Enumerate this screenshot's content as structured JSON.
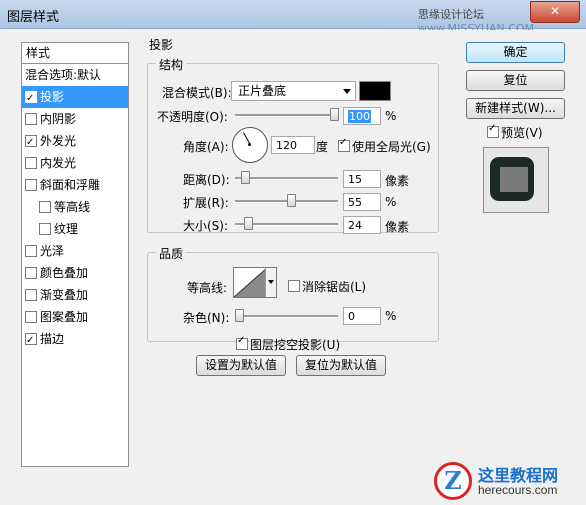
{
  "window": {
    "title": "图层样式",
    "watermark_top": "思缘设计论坛",
    "watermark_site": "www.MISSYUAN.COM"
  },
  "sidebar": {
    "header": "样式",
    "blend": "混合选项:默认",
    "items": [
      {
        "label": "投影",
        "checked": true,
        "selected": true,
        "indent": false
      },
      {
        "label": "内阴影",
        "checked": false,
        "selected": false,
        "indent": false
      },
      {
        "label": "外发光",
        "checked": true,
        "selected": false,
        "indent": false
      },
      {
        "label": "内发光",
        "checked": false,
        "selected": false,
        "indent": false
      },
      {
        "label": "斜面和浮雕",
        "checked": false,
        "selected": false,
        "indent": false
      },
      {
        "label": "等高线",
        "checked": false,
        "selected": false,
        "indent": true
      },
      {
        "label": "纹理",
        "checked": false,
        "selected": false,
        "indent": true
      },
      {
        "label": "光泽",
        "checked": false,
        "selected": false,
        "indent": false
      },
      {
        "label": "颜色叠加",
        "checked": false,
        "selected": false,
        "indent": false
      },
      {
        "label": "渐变叠加",
        "checked": false,
        "selected": false,
        "indent": false
      },
      {
        "label": "图案叠加",
        "checked": false,
        "selected": false,
        "indent": false
      },
      {
        "label": "描边",
        "checked": true,
        "selected": false,
        "indent": false
      }
    ]
  },
  "drop_shadow": {
    "section_title": "投影",
    "structure": {
      "title": "结构",
      "blend_mode_label": "混合模式(B):",
      "blend_mode_value": "正片叠底",
      "shadow_color": "#000000",
      "opacity_label": "不透明度(O):",
      "opacity_value": "100",
      "opacity_unit": "%",
      "angle_label": "角度(A):",
      "angle_value": "120",
      "angle_unit": "度",
      "global_light_label": "使用全局光(G)",
      "global_light_checked": true,
      "distance_label": "距离(D):",
      "distance_value": "15",
      "distance_unit": "像素",
      "spread_label": "扩展(R):",
      "spread_value": "55",
      "spread_unit": "%",
      "size_label": "大小(S):",
      "size_value": "24",
      "size_unit": "像素"
    },
    "quality": {
      "title": "品质",
      "contour_label": "等高线:",
      "antialias_label": "消除锯齿(L)",
      "antialias_checked": false,
      "noise_label": "杂色(N):",
      "noise_value": "0",
      "noise_unit": "%"
    },
    "knockout_label": "图层挖空投影(U)",
    "knockout_checked": true,
    "make_default": "设置为默认值",
    "reset_default": "复位为默认值"
  },
  "buttons": {
    "ok": "确定",
    "reset": "复位",
    "new_style": "新建样式(W)...",
    "preview_label": "预览(V)",
    "preview_checked": true
  },
  "watermark_logo": {
    "name": "这里教程网",
    "url": "herecours.com"
  }
}
